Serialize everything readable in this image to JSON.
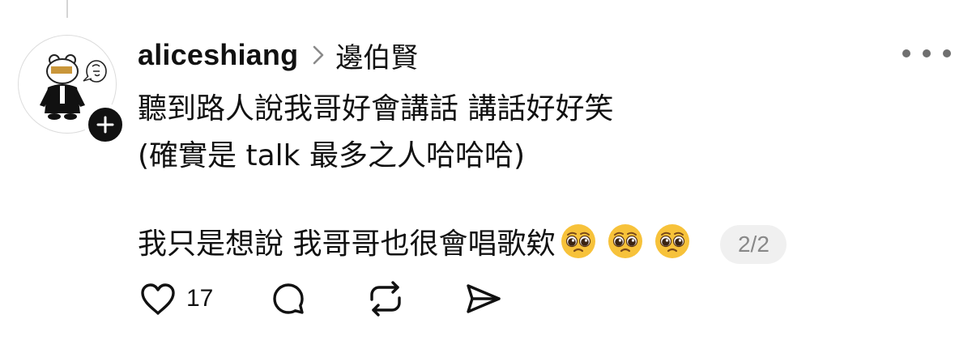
{
  "post": {
    "username": "aliceshiang",
    "reply_to": "邊伯賢",
    "text_line1": "聽到路人說我哥好會講話 講話好好笑",
    "text_line2": "(確實是 talk 最多之人哈哈哈)",
    "text_line3": "我只是想說 我哥哥也很會唱歌欸",
    "emojis": [
      "pleading-face",
      "pleading-face",
      "pleading-face"
    ],
    "page_indicator": "2/2"
  },
  "actions": {
    "like_count": "17",
    "icons": [
      "heart-icon",
      "comment-icon",
      "repost-icon",
      "share-icon"
    ]
  },
  "colors": {
    "text": "#111111",
    "muted": "#888888",
    "pill_bg": "#f0f0f0",
    "emoji_yellow": "#f7c23a"
  }
}
